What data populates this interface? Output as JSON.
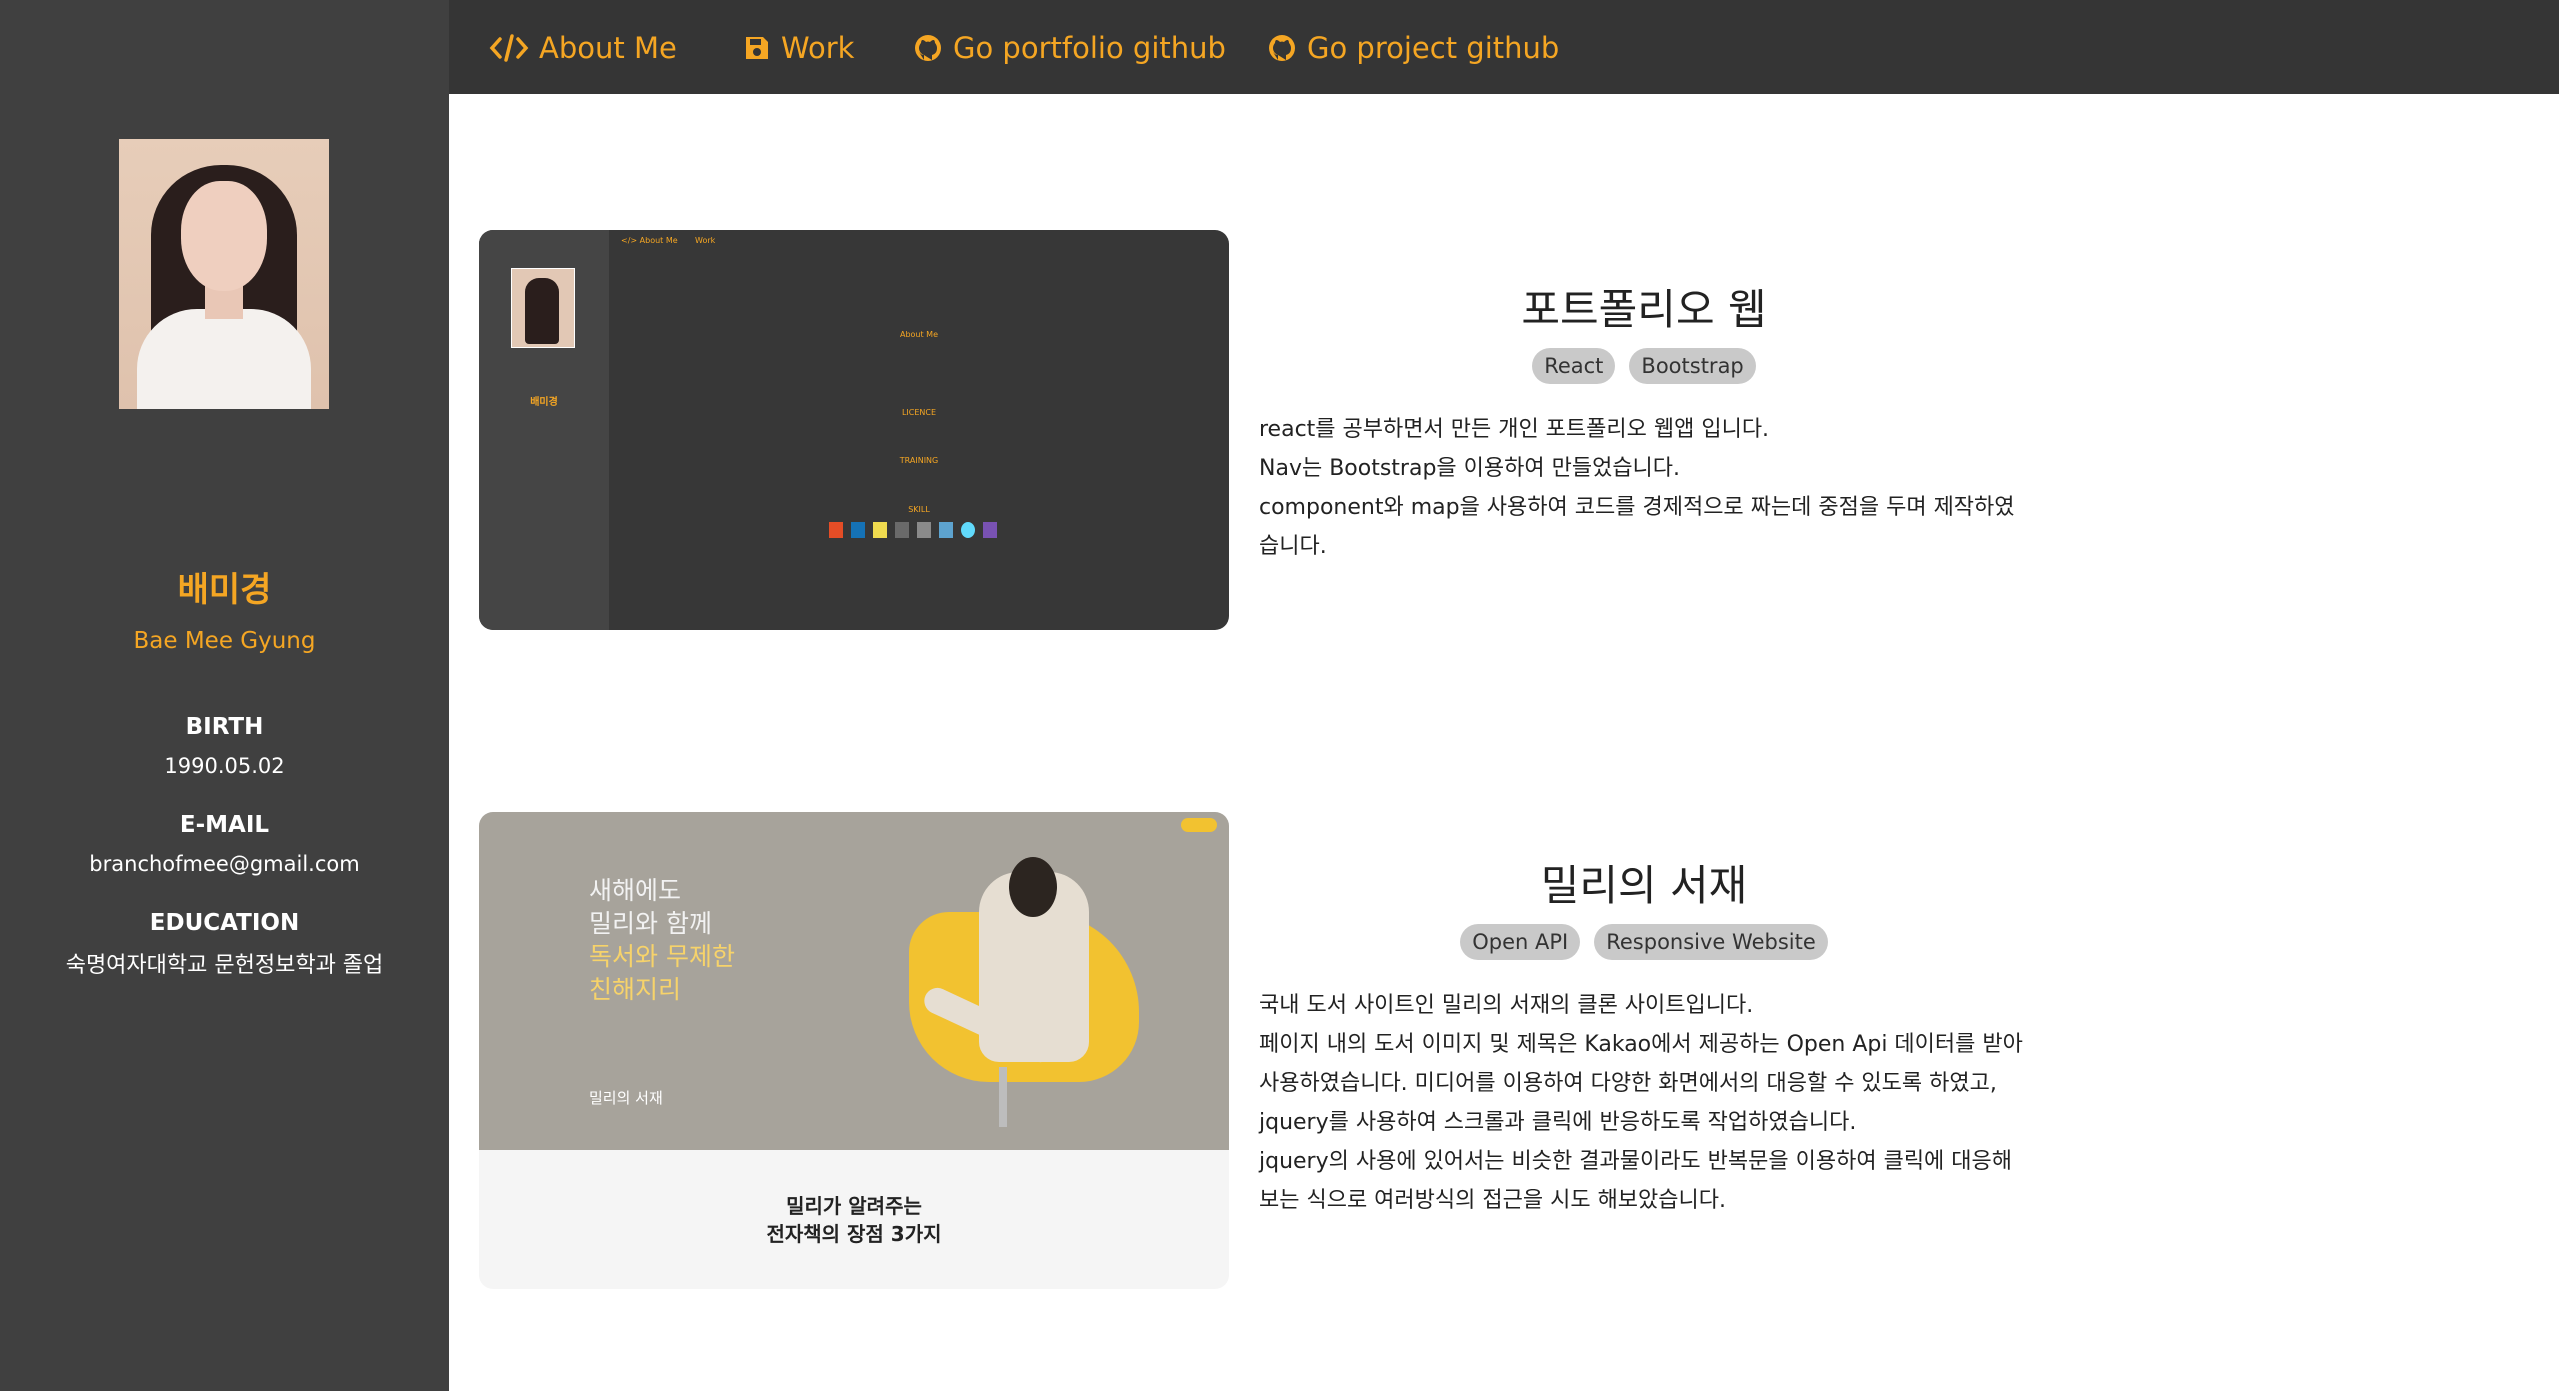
{
  "nav": {
    "items": [
      {
        "label": "About Me",
        "icon": "code-icon"
      },
      {
        "label": "Work",
        "icon": "floppy-disk-icon"
      },
      {
        "label": "Go portfolio github",
        "icon": "github-icon"
      },
      {
        "label": "Go project github",
        "icon": "github-icon"
      }
    ]
  },
  "profile": {
    "name_ko": "배미경",
    "name_en": "Bae Mee Gyung",
    "birth_label": "BIRTH",
    "birth": "1990.05.02",
    "email_label": "E-MAIL",
    "email": "branchofmee@gmail.com",
    "education_label": "EDUCATION",
    "education": "숙명여자대학교 문헌정보학과 졸업"
  },
  "projects": [
    {
      "title": "포트폴리오 웹",
      "tags": [
        "React",
        "Bootstrap"
      ],
      "description": [
        "react를 공부하면서 만든 개인 포트폴리오 웹앱 입니다.",
        "Nav는 Bootstrap을 이용하여 만들었습니다.",
        "component와 map을 사용하여 코드를 경제적으로 짜는데 중점을 두며 제작하였",
        "습니다."
      ],
      "thumb": {
        "nav1": "</> About Me",
        "nav2": "Work",
        "name": "배미경",
        "about": "About Me",
        "licence": "LICENCE",
        "training": "TRAINING",
        "skill": "SKILL"
      }
    },
    {
      "title": "밀리의 서재",
      "tags": [
        "Open API",
        "Responsive Website"
      ],
      "description": [
        "국내 도서 사이트인 밀리의 서재의 클론 사이트입니다.",
        "페이지 내의 도서 이미지 및 제목은 Kakao에서 제공하는 Open Api 데이터를 받아",
        "사용하였습니다. 미디어를 이용하여 다양한 화면에서의 대응할 수 있도록 하였고,",
        "jquery를 사용하여 스크롤과 클릭에 반응하도록 작업하였습니다.",
        "jquery의 사용에 있어서는 비슷한 결과물이라도 반복문을 이용하여 클릭에 대응해",
        "보는 식으로 여러방식의 접근을 시도 해보았습니다."
      ],
      "thumb": {
        "hero_line1": "새해에도",
        "hero_line2": "밀리와 함께",
        "hero_line3": "독서와 무제한",
        "hero_line4": "친해지리",
        "logo": "밀리의 서재",
        "bottom_title1": "밀리가 알려주는",
        "bottom_title2": "전자책의 장점 3가지"
      }
    }
  ],
  "colors": {
    "accent": "#f5a623",
    "sidebar": "#404040",
    "navbar": "#353535",
    "tag_bg": "#c9c9c9"
  }
}
